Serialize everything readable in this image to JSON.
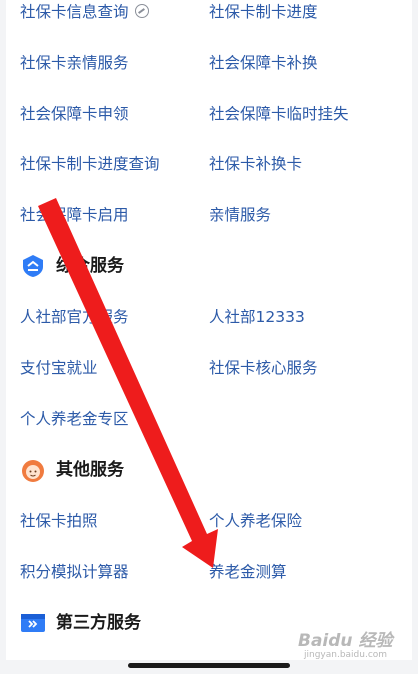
{
  "rows_top": [
    {
      "left": "社保卡信息查询",
      "right": "社保卡制卡进度"
    },
    {
      "left": "社保卡亲情服务",
      "right": "社会保障卡补换"
    },
    {
      "left": "社会保障卡申领",
      "right": "社会保障卡临时挂失"
    },
    {
      "left": "社保卡制卡进度查询",
      "right": "社保卡补换卡"
    },
    {
      "left": "社会保障卡启用",
      "right": "亲情服务"
    }
  ],
  "sections": {
    "comprehensive": {
      "title": "综合服务",
      "icon": "shield-icon",
      "color": "#2f7cf6",
      "rows": [
        {
          "left": "人社部官方服务",
          "right": "人社部12333"
        },
        {
          "left": "支付宝就业",
          "right": "社保卡核心服务"
        },
        {
          "left": "个人养老金专区",
          "right": ""
        }
      ]
    },
    "other": {
      "title": "其他服务",
      "icon": "avatar-icon",
      "color": "#f07b3f",
      "rows": [
        {
          "left": "社保卡拍照",
          "right": "个人养老保险"
        },
        {
          "left": "积分模拟计算器",
          "right": "养老金测算"
        }
      ]
    },
    "third_party": {
      "title": "第三方服务",
      "icon": "card-icon",
      "color": "#2f7cf6"
    }
  },
  "colors": {
    "link": "#2c5aa8",
    "annotation_arrow": "#ee1c1c"
  },
  "watermark": {
    "brand": "Baidu 经验",
    "sub": "jingyan.baidu.com"
  }
}
